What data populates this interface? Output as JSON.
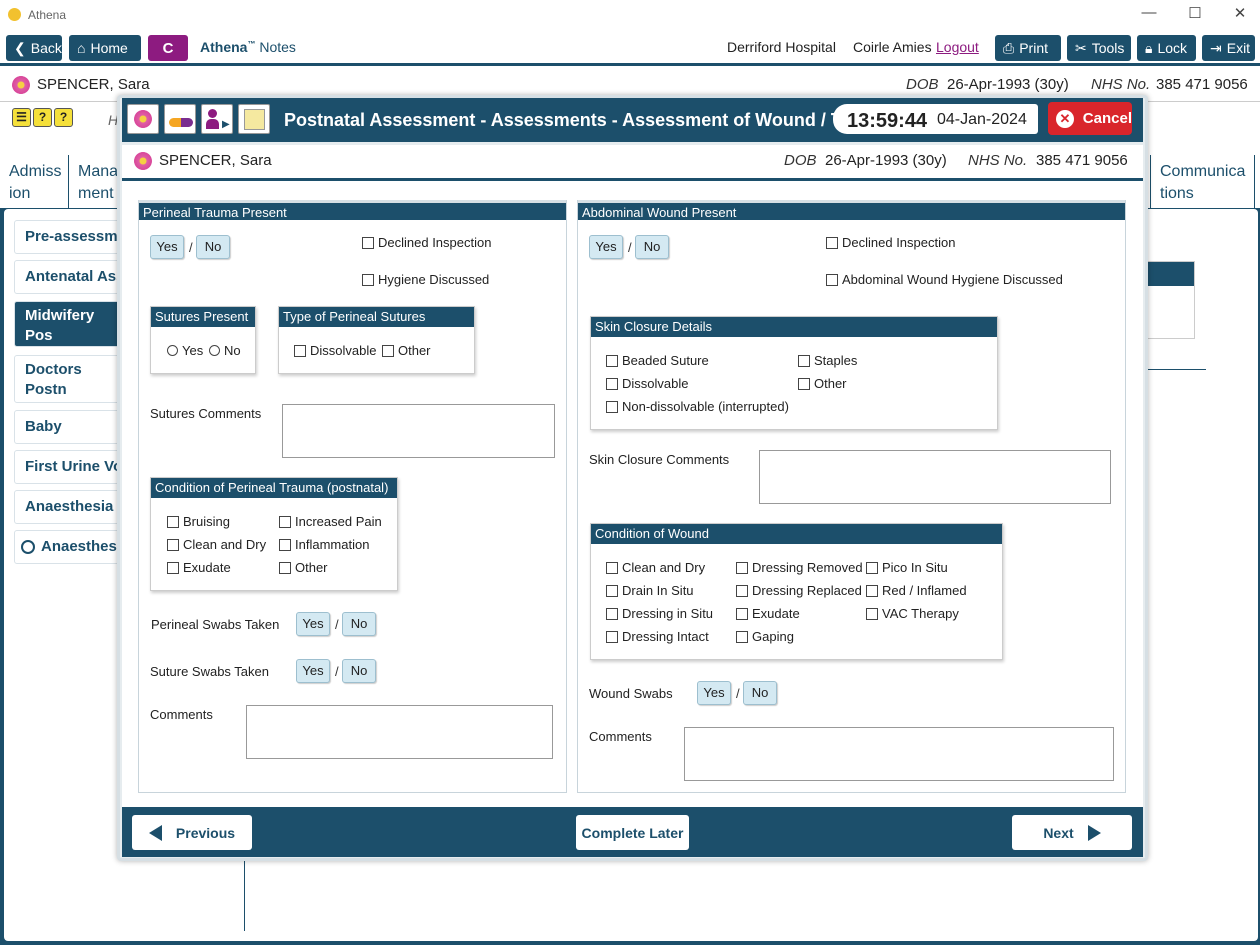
{
  "window": {
    "app_name": "Athena"
  },
  "toolbar": {
    "back": "Back",
    "home": "Home",
    "c_button": "C",
    "athena": "Athena",
    "tm": "™",
    "notes": " Notes",
    "hospital": "Derriford Hospital",
    "user": "Coirle Amies",
    "logout": "Logout",
    "print": "Print",
    "tools": "Tools",
    "lock": "Lock",
    "exit": "Exit"
  },
  "patient": {
    "name": "SPENCER, Sara",
    "dob_label": "DOB",
    "dob": "26-Apr-1993 (30y)",
    "nhs_label": "NHS No.",
    "nhs": "385 471 9056"
  },
  "background": {
    "h_letter": "H",
    "tabs": [
      "Admiss\nion",
      "Mana\nment",
      "Communica\ntions"
    ],
    "sidebar": [
      "Pre-assessmen",
      "Antenatal Ass",
      "Midwifery Pos\nAssessments",
      "Doctors Postn\nAssessments",
      "Baby",
      "First Urine Voi",
      "Anaesthesia In",
      "Anaesthesia"
    ]
  },
  "modal": {
    "title": "Postnatal Assessment - Assessments - Assessment of Wound / Trauma",
    "time": "13:59:44",
    "date": "04-Jan-2024",
    "cancel": "Cancel"
  },
  "left": {
    "title": "Perineal Trauma Present",
    "yes": "Yes",
    "no": "No",
    "declined": "Declined Inspection",
    "hygiene": "Hygiene Discussed",
    "sutures_present": {
      "title": "Sutures Present",
      "yes": "Yes",
      "no": "No"
    },
    "suture_type": {
      "title": "Type of Perineal Sutures",
      "opt1": "Dissolvable",
      "opt2": "Other"
    },
    "sutures_comments": "Sutures Comments",
    "condition": {
      "title": "Condition of Perineal Trauma (postnatal)",
      "items": [
        "Bruising",
        "Increased Pain",
        "Clean and Dry",
        "Inflammation",
        "Exudate",
        "Other"
      ]
    },
    "perineal_swabs": "Perineal Swabs Taken",
    "suture_swabs": "Suture Swabs Taken",
    "comments": "Comments"
  },
  "right": {
    "title": "Abdominal Wound Present",
    "yes": "Yes",
    "no": "No",
    "declined": "Declined Inspection",
    "hygiene": "Abdominal Wound Hygiene Discussed",
    "skin_closure": {
      "title": "Skin Closure Details",
      "items": [
        "Beaded Suture",
        "Staples",
        "Dissolvable",
        "Other",
        "Non-dissolvable (interrupted)"
      ]
    },
    "skin_comments": "Skin Closure Comments",
    "condition": {
      "title": "Condition of Wound",
      "items": [
        "Clean and Dry",
        "Dressing Removed",
        "Pico In Situ",
        "Drain In Situ",
        "Dressing Replaced",
        "Red / Inflamed",
        "Dressing in Situ",
        "Exudate",
        "VAC Therapy",
        "Dressing Intact",
        "Gaping"
      ]
    },
    "wound_swabs": "Wound Swabs",
    "comments": "Comments"
  },
  "footer": {
    "previous": "Previous",
    "complete_later": "Complete Later",
    "next": "Next"
  },
  "colors": {
    "primary": "#1c4f6b",
    "accent": "#8d1b80",
    "cancel": "#d9252b",
    "button_bg": "#d4e9f2"
  }
}
